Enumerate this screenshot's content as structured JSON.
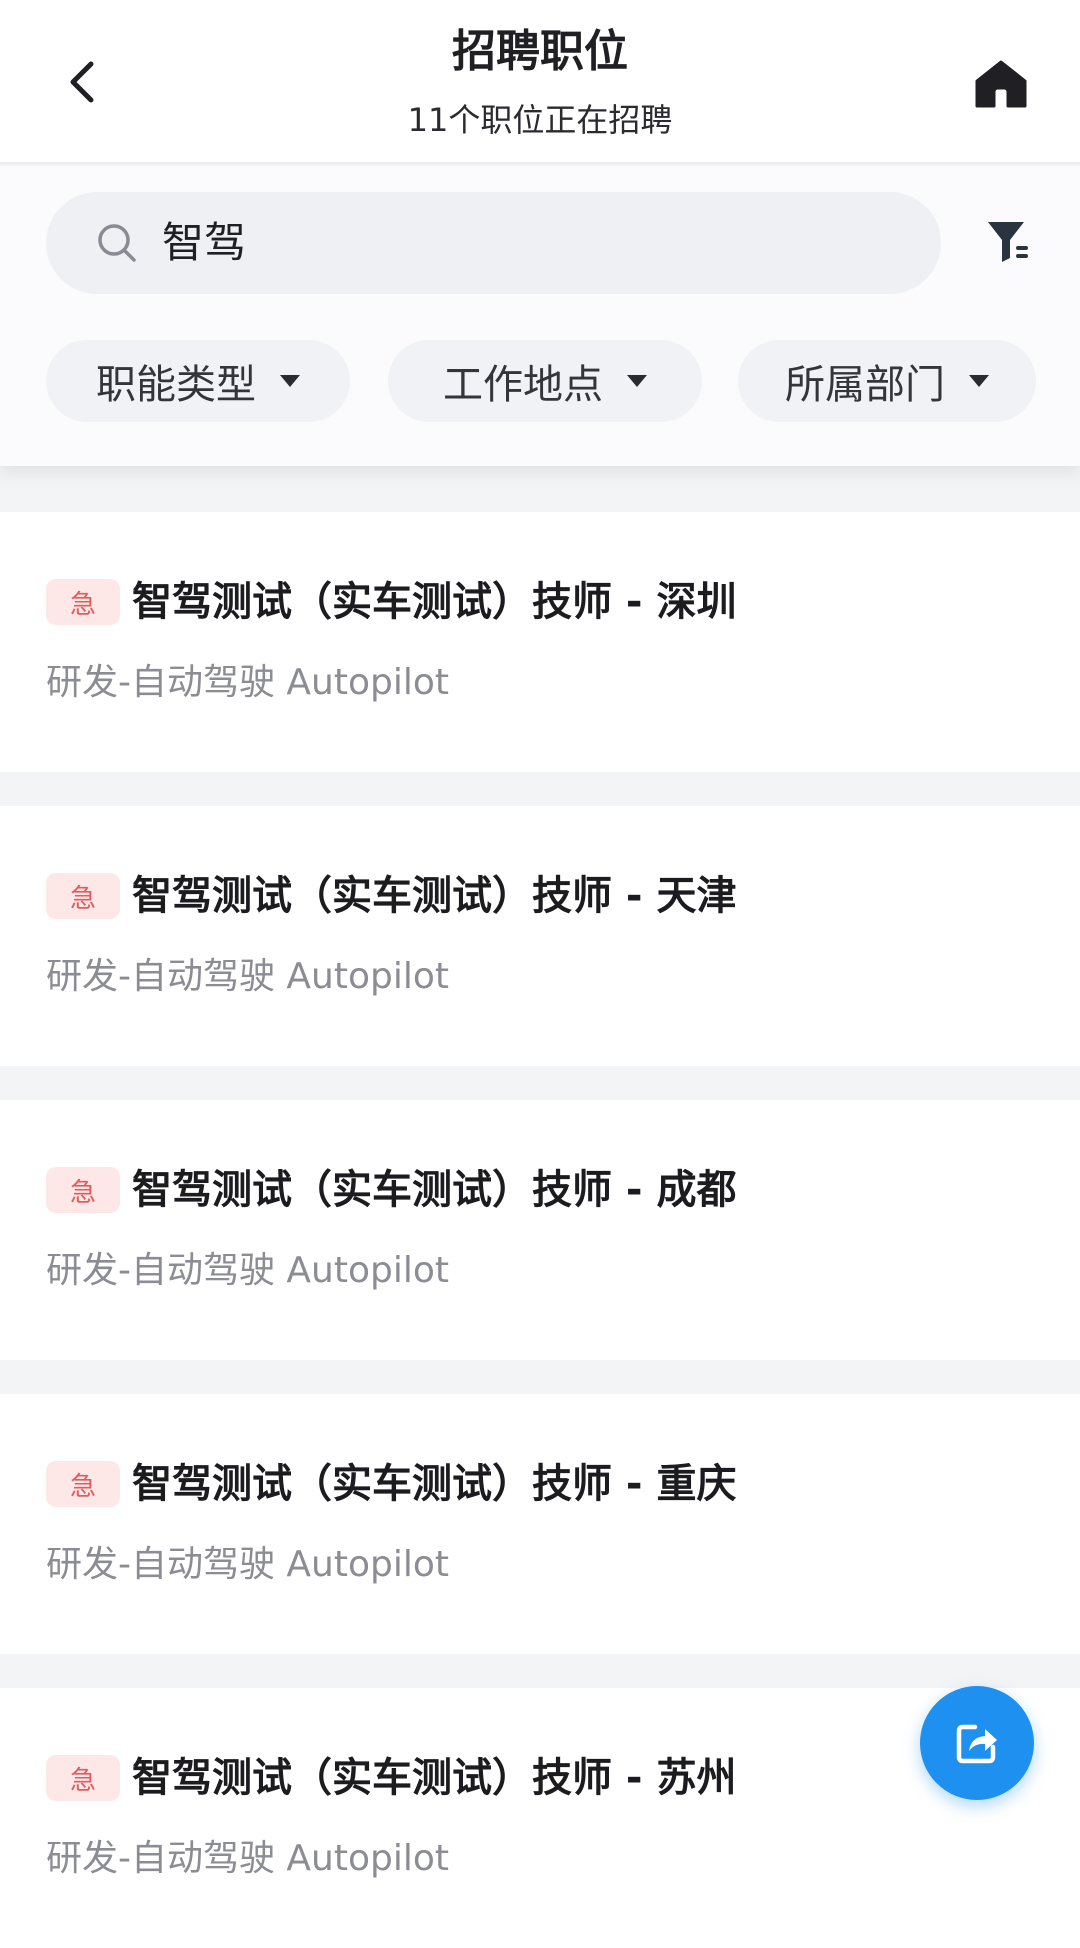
{
  "header": {
    "title": "招聘职位",
    "subtitle": "11个职位正在招聘"
  },
  "search": {
    "value": "智驾"
  },
  "filters": [
    {
      "label": "职能类型"
    },
    {
      "label": "工作地点"
    },
    {
      "label": "所属部门"
    }
  ],
  "jobs": [
    {
      "badge": "急",
      "title": "智驾测试（实车测试）技师 - 深圳",
      "department": "研发-自动驾驶 Autopilot"
    },
    {
      "badge": "急",
      "title": "智驾测试（实车测试）技师 - 天津",
      "department": "研发-自动驾驶 Autopilot"
    },
    {
      "badge": "急",
      "title": "智驾测试（实车测试）技师 - 成都",
      "department": "研发-自动驾驶 Autopilot"
    },
    {
      "badge": "急",
      "title": "智驾测试（实车测试）技师 - 重庆",
      "department": "研发-自动驾驶 Autopilot"
    },
    {
      "badge": "急",
      "title": "智驾测试（实车测试）技师 - 苏州",
      "department": "研发-自动驾驶 Autopilot"
    }
  ],
  "icons": {
    "back": "chevron-left-icon",
    "home": "home-icon",
    "search": "search-icon",
    "filter": "filter-icon",
    "share": "share-icon"
  },
  "colors": {
    "accent": "#1e90f0",
    "urgent_bg": "#fde7e7",
    "urgent_text": "#e25c5c"
  }
}
